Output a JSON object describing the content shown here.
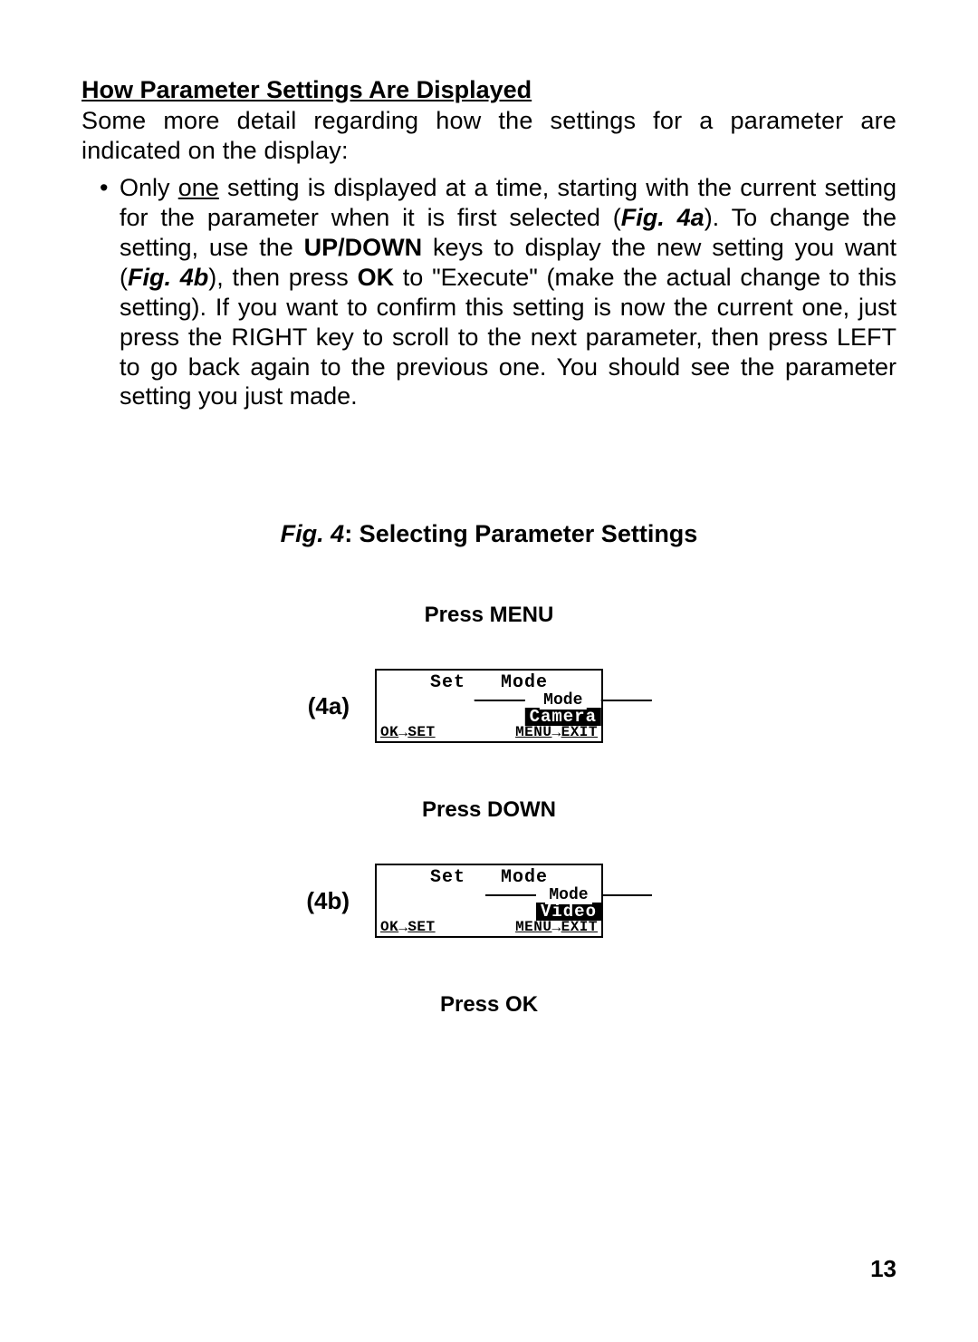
{
  "section_heading": "How Parameter Settings Are Displayed",
  "intro_text": "Some more detail regarding how the settings for a parameter are indicated on the display:",
  "bullet": {
    "part1": "Only ",
    "one": "one",
    "part2": " setting is displayed at a time, starting with the current setting for the parameter when it is first selected (",
    "fig4a": "Fig. 4a",
    "part3": "). To change the setting, use the ",
    "updown": "UP/DOWN",
    "part4": " keys to display the new setting you want (",
    "fig4b": "Fig. 4b",
    "part5": "), then press ",
    "ok": "OK",
    "part6": " to \"Execute\" (make the actual change to this setting). If you want to confirm this setting is now the current one, just press the RIGHT key to scroll to the next parameter, then press LEFT to go back again to the previous one. You should see the parameter setting you just made."
  },
  "figure": {
    "label_prefix": "Fig. 4",
    "label_rest": ": Selecting Parameter Settings",
    "step1": "Press MENU",
    "step2": "Press DOWN",
    "step3": "Press OK",
    "panel_a_tag": "(4a)",
    "panel_b_tag": "(4b)",
    "lcd": {
      "top_left": "Set",
      "top_right": "Mode",
      "mid_label": "Mode",
      "selected_a": "Camera",
      "selected_b": "Video",
      "bottom_left_ok": "OK",
      "bottom_left_set": "SET",
      "bottom_right_menu": "MENU",
      "bottom_right_exit": "EXIT"
    }
  },
  "page_number": "13"
}
